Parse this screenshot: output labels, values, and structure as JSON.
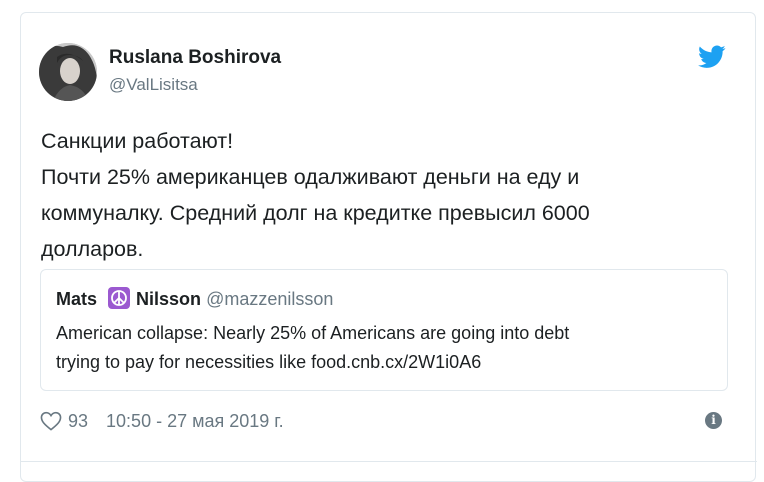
{
  "author": {
    "name": "Ruslana Boshirova",
    "handle": "@ValLisitsa"
  },
  "tweet": {
    "lines": [
      "Санкции работают!",
      "Почти 25% американцев одалживают деньги на еду и",
      "коммуналку. Средний долг на кредитке превысил 6000",
      "долларов."
    ]
  },
  "quoted": {
    "name_first": "Mats",
    "name_last": "Nilsson",
    "handle": "@mazzenilsson",
    "lines": [
      "American collapse: Nearly 25% of Americans are going into debt",
      "trying to pay for necessities like food.cnb.cx/2W1i0A6"
    ]
  },
  "footer": {
    "likes": "93",
    "timestamp": "10:50 - 27 мая 2019 г."
  },
  "icons": {
    "bird": "twitter-bird-icon",
    "heart": "heart-icon",
    "info": "info-icon",
    "peace": "peace-symbol-icon"
  },
  "colors": {
    "brand_blue": "#1da1f2",
    "text": "#1c2022",
    "muted": "#697882",
    "border": "#e1e8ed",
    "emoji_purple": "#9b59d0"
  }
}
